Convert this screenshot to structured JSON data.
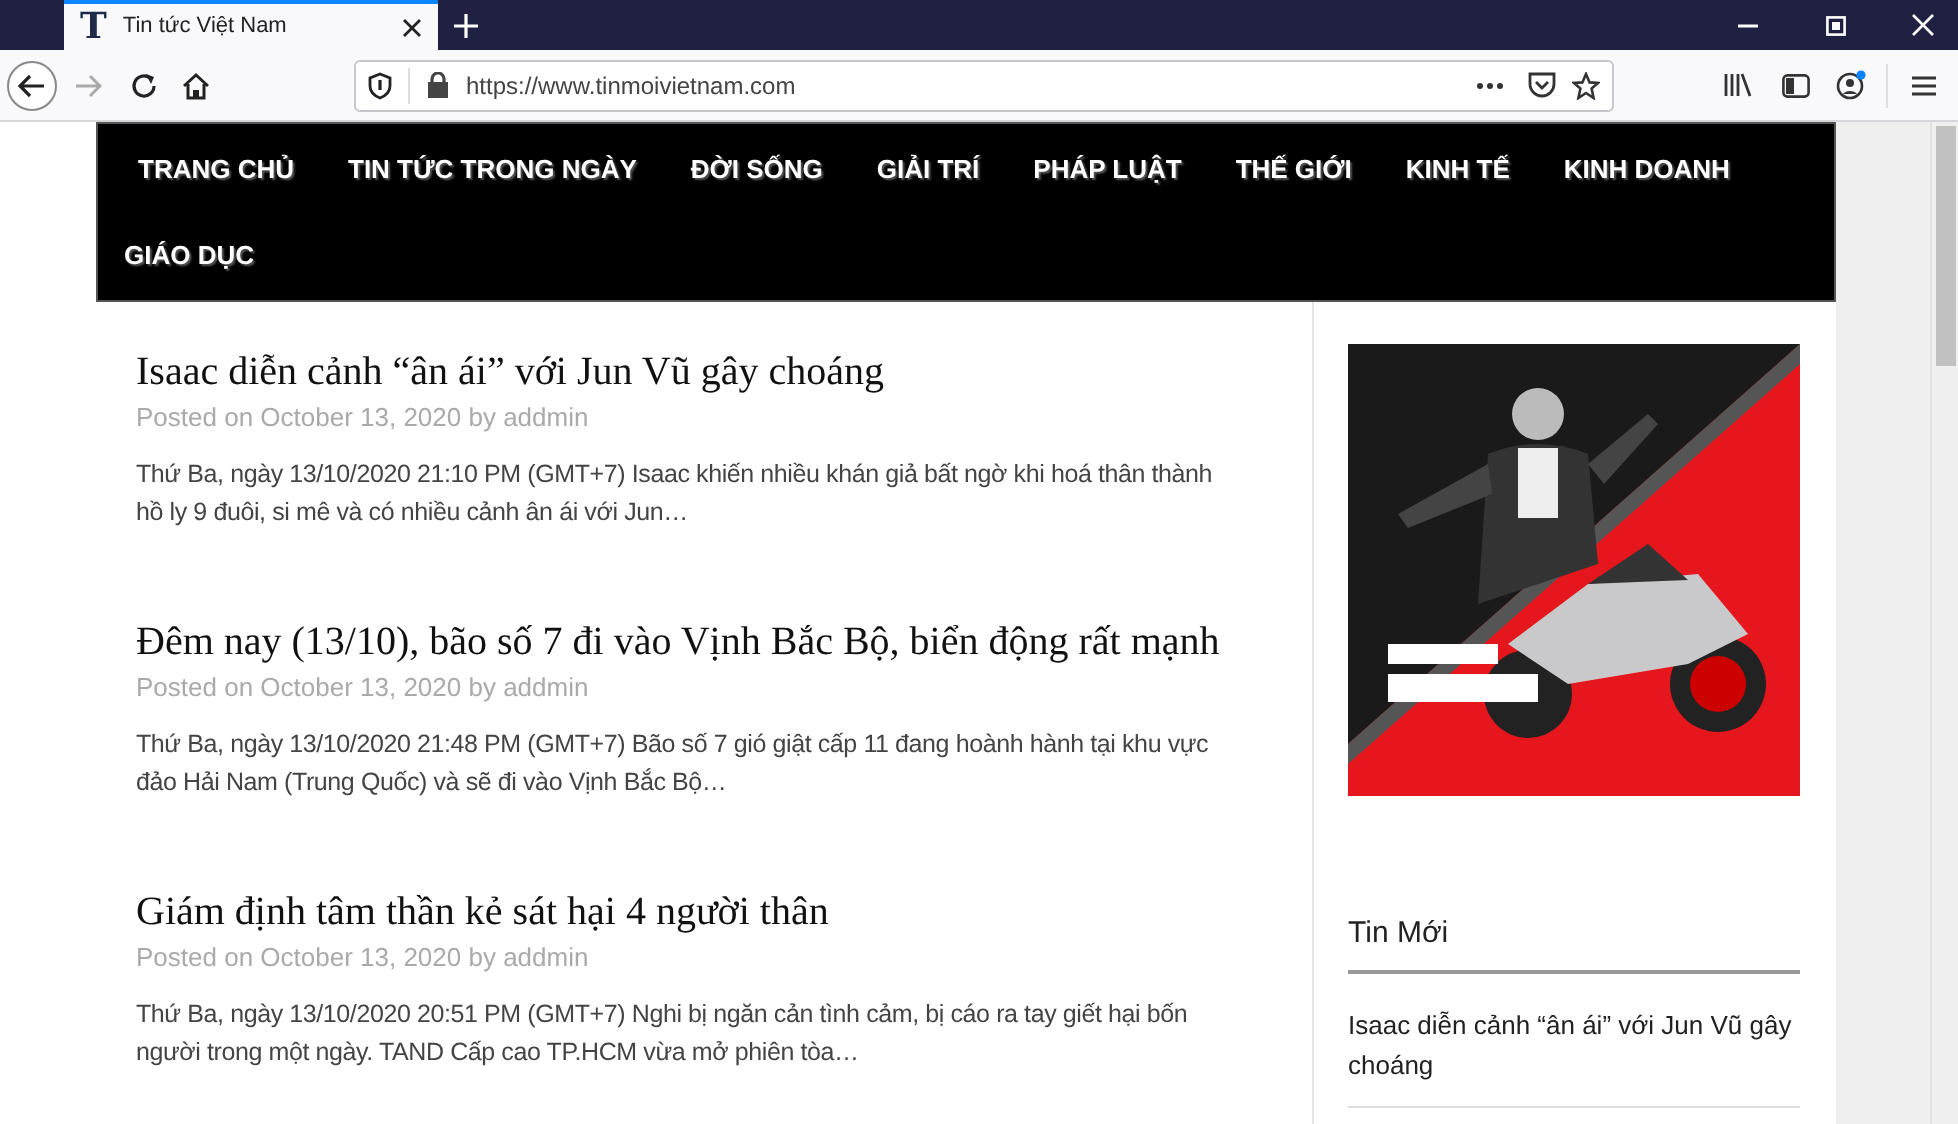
{
  "browser": {
    "tabs": [
      {
        "title": "Tin tức Việt Nam",
        "favicon": "T",
        "selected": true
      }
    ],
    "url": "https://www.tinmoivietnam.com"
  },
  "nav": {
    "items": [
      {
        "label": "TRANG CHỦ"
      },
      {
        "label": "TIN TỨC TRONG NGÀY"
      },
      {
        "label": "ĐỜI SỐNG"
      },
      {
        "label": "GIẢI TRÍ"
      },
      {
        "label": "PHÁP LUẬT"
      },
      {
        "label": "THẾ GIỚI"
      },
      {
        "label": "KINH TẾ"
      },
      {
        "label": "KINH DOANH"
      },
      {
        "label": "GIÁO DỤC"
      }
    ]
  },
  "posts": [
    {
      "title": "Isaac diễn cảnh “ân ái” với Jun Vũ gây choáng",
      "meta": "Posted on October 13, 2020 by addmin",
      "excerpt": "Thứ Ba, ngày 13/10/2020 21:10 PM (GMT+7) Isaac khiến nhiều khán giả bất ngờ khi hoá thân thành hồ ly 9 đuôi, si mê và có nhiều cảnh ân ái với Jun…"
    },
    {
      "title": "Đêm nay (13/10), bão số 7 đi vào Vịnh Bắc Bộ, biển động rất mạnh",
      "meta": "Posted on October 13, 2020 by addmin",
      "excerpt": "Thứ Ba, ngày 13/10/2020 21:48 PM (GMT+7) Bão số 7 gió giật cấp 11 đang hoành hành tại khu vực đảo Hải Nam (Trung Quốc) và sẽ đi vào Vịnh Bắc Bộ…"
    },
    {
      "title": "Giám định tâm thần kẻ sát hại 4 người thân",
      "meta": "Posted on October 13, 2020 by addmin",
      "excerpt": "Thứ Ba, ngày 13/10/2020 20:51 PM (GMT+7) Nghi bị ngăn cản tình cảm, bị cáo ra tay giết hại bốn người trong một ngày. TAND Cấp cao TP.HCM vừa mở phiên tòa…"
    }
  ],
  "sidebar": {
    "widget_title": "Tin Mới",
    "items": [
      "Isaac diễn cảnh “ân ái” với Jun Vũ gây choáng"
    ]
  }
}
